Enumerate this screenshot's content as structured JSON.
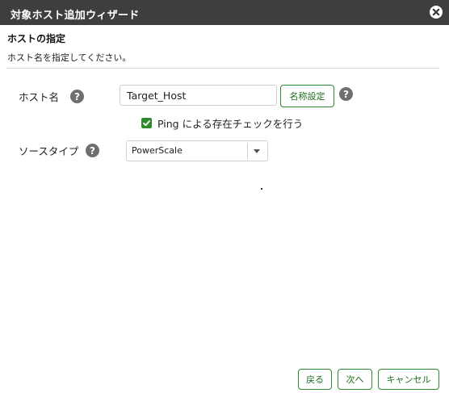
{
  "window": {
    "title": "対象ホスト追加ウィザード",
    "close_icon": "close-circle-icon"
  },
  "section": {
    "title": "ホストの指定",
    "description": "ホスト名を指定してください。"
  },
  "host_name": {
    "label": "ホスト名",
    "help_icon": "help-icon",
    "help_glyph": "?",
    "value": "Target_Host",
    "name_button_label": "名称設定"
  },
  "ping_check": {
    "checked": true,
    "label": "Ping による存在チェックを行う"
  },
  "source_type": {
    "label": "ソースタイプ",
    "help_glyph": "?",
    "selected": "PowerScale"
  },
  "footer": {
    "back_label": "戻る",
    "next_label": "次へ",
    "cancel_label": "キャンセル"
  },
  "colors": {
    "titlebar": "#3e3e3e",
    "accent": "#2e8b2e",
    "help_icon": "#6f6f6f"
  }
}
